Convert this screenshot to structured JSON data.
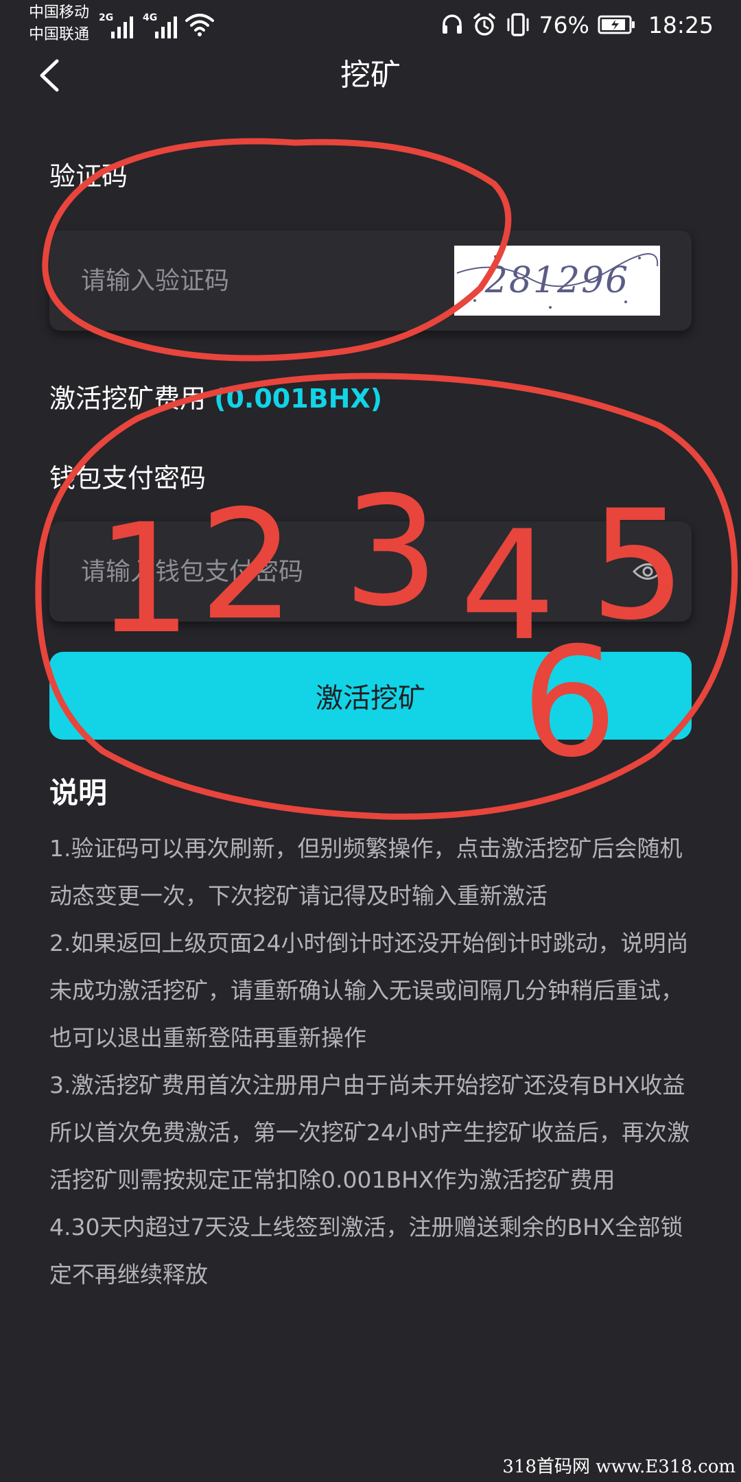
{
  "status_bar": {
    "carrier_1": "中国移动",
    "carrier_2": "中国联通",
    "network_1": "2G",
    "network_2": "4G",
    "battery": "76%",
    "time": "18:25",
    "icons": [
      "signal-icon",
      "wifi-icon",
      "headset-icon",
      "alarm-icon",
      "vibrate-icon",
      "battery-icon"
    ]
  },
  "header": {
    "title": "挖矿",
    "back_icon": "chevron-left-icon"
  },
  "form": {
    "captcha": {
      "label": "验证码",
      "placeholder": "请输入验证码",
      "value": "",
      "image_code": "281296"
    },
    "fee": {
      "label": "激活挖矿费用",
      "value": "(0.001BHX)"
    },
    "password": {
      "label": "钱包支付密码",
      "placeholder": "请输入钱包支付密码",
      "value": "",
      "toggle_icon": "eye-icon"
    },
    "submit_label": "激活挖矿"
  },
  "notes": {
    "title": "说明",
    "items": [
      "1.验证码可以再次刷新，但别频繁操作，点击激活挖矿后会随机动态变更一次，下次挖矿请记得及时输入重新激活",
      "2.如果返回上级页面24小时倒计时还没开始倒计时跳动，说明尚未成功激活挖矿，请重新确认输入无误或间隔几分钟稍后重试，也可以退出重新登陆再重新操作",
      "3.激活挖矿费用首次注册用户由于尚未开始挖矿还没有BHX收益所以首次免费激活，第一次挖矿24小时产生挖矿收益后，再次激活挖矿则需按规定正常扣除0.001BHX作为激活挖矿费用",
      "4.30天内超过7天没上线签到激活，注册赠送剩余的BHX全部锁定不再继续释放"
    ]
  },
  "annotations": {
    "handwritten_digits": [
      "1",
      "2",
      "3",
      "4",
      "5",
      "6"
    ],
    "color": "#e8453c"
  },
  "watermark": "318首码网 www.E318.com",
  "colors": {
    "background": "#25252a",
    "accent": "#12d4e6",
    "card": "#2b2b30",
    "note_text": "#b3b3b8"
  }
}
